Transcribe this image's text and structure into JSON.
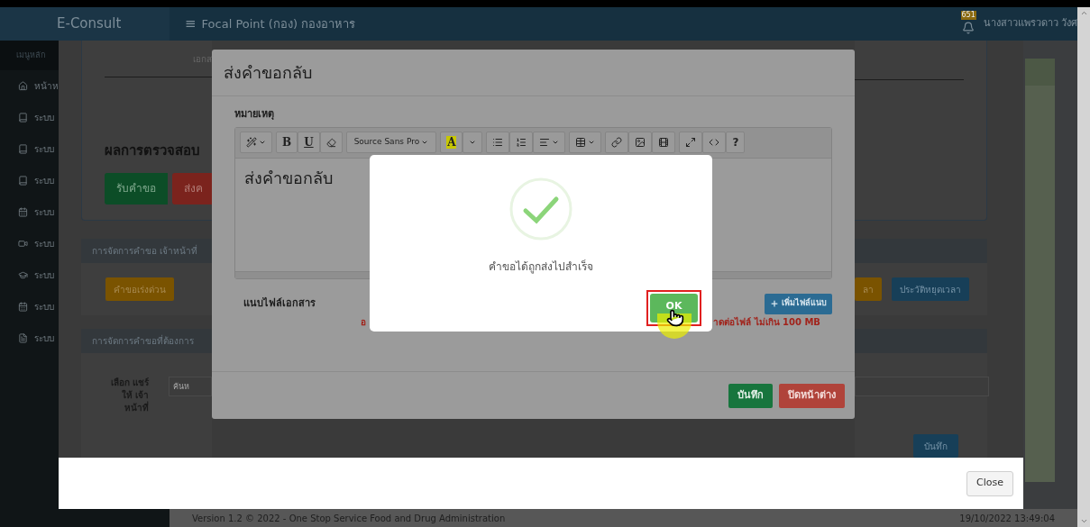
{
  "header": {
    "brand": "E-Consult",
    "menu_glyph": "≡",
    "title": "Focal Point (กอง) กองอาหาร",
    "notification_count": "651",
    "user_name": "นางสาวแพรวดาว วังศ"
  },
  "sidebar": {
    "title": "เมนูหลัก",
    "items": [
      {
        "label": "หน้าห",
        "kind": "home"
      },
      {
        "label": "ระบบ",
        "kind": "book"
      },
      {
        "label": "ระบบ",
        "kind": "book"
      },
      {
        "label": "ระบบ",
        "kind": "book"
      },
      {
        "label": "ระบบ",
        "kind": "calendar"
      },
      {
        "label": "ระบบ",
        "kind": "video"
      },
      {
        "label": "ระบบ",
        "kind": "graduation"
      },
      {
        "label": "ระบบ",
        "kind": "calendar"
      },
      {
        "label": "ระบบ",
        "kind": "file"
      }
    ]
  },
  "background": {
    "card": {
      "label": "เอกส",
      "heading": "ผลการตรวจสอบ",
      "buttons": [
        {
          "label": "รับคำขอ",
          "kind": "success"
        },
        {
          "label": "ส่งค",
          "kind": "danger"
        }
      ]
    },
    "panel_1": {
      "title": "การจัดการคำขอ เจ้าหน้าที่",
      "left_buttons": [
        {
          "label": "คำขอเร่งด่วน",
          "kind": "warning"
        }
      ],
      "right_buttons": [
        {
          "label": "ลา",
          "kind": "warning"
        },
        {
          "label": "ประวัติหยุดเวลา",
          "kind": "primary"
        }
      ]
    },
    "panel_2": {
      "title": "การจัดการคำขอที่ต้องการ",
      "field_label": "เลือก แชร์ให้ เจ้าหน้าที่",
      "placeholder": "ค้นห",
      "button": "บันทึก"
    },
    "close_button": "Close"
  },
  "dialog": {
    "title": "ส่งคำขอกลับ",
    "note_label": "หมายเหตุ",
    "toolbar": {
      "bold": "B",
      "underline": "U",
      "font": "Source Sans Pro",
      "highlight_glyph": "A",
      "help": "?"
    },
    "editor_text": "ส่งคำขอกลับ",
    "attach_label": "แนบไฟล์เอกสาร",
    "attach_button": "เพิ่มไฟล์แนบ",
    "notice_parts": [
      "อ",
      "าดต่อไฟล์ ไม่เกิน 100 MB"
    ],
    "buttons": [
      {
        "label": "บันทึก",
        "kind": "success"
      },
      {
        "label": "ปิดหน้าต่าง",
        "kind": "danger"
      }
    ]
  },
  "alert": {
    "message": "คำขอได้ถูกส่งไปสำเร็จ",
    "button": "OK"
  },
  "footer": {
    "version": "Version 1.2 © 2022 - One Stop Service Food and Drug Administration",
    "timestamp": "19/10/2022 13:49:04"
  }
}
